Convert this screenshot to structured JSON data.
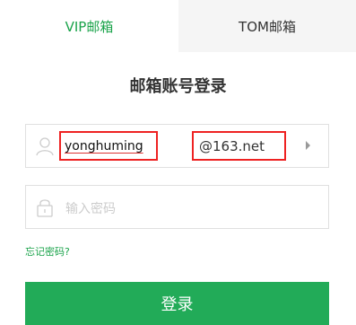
{
  "tabs": {
    "vip_label": "VIP邮箱",
    "tom_label": "TOM邮箱"
  },
  "login": {
    "title": "邮箱账号登录",
    "username_value": "yonghuming",
    "domain_value": "@163.net",
    "password_placeholder": "输入密码",
    "forgot_label": "忘记密码?",
    "submit_label": "登录"
  },
  "icons": {
    "user": "user-icon",
    "lock": "lock-icon",
    "domain_dropdown": "caret-right-icon"
  },
  "colors": {
    "accent_green": "#1aa34a",
    "button_green": "#22ab58",
    "highlight_red": "#e22222",
    "inactive_tab_bg": "#f5f5f5"
  }
}
